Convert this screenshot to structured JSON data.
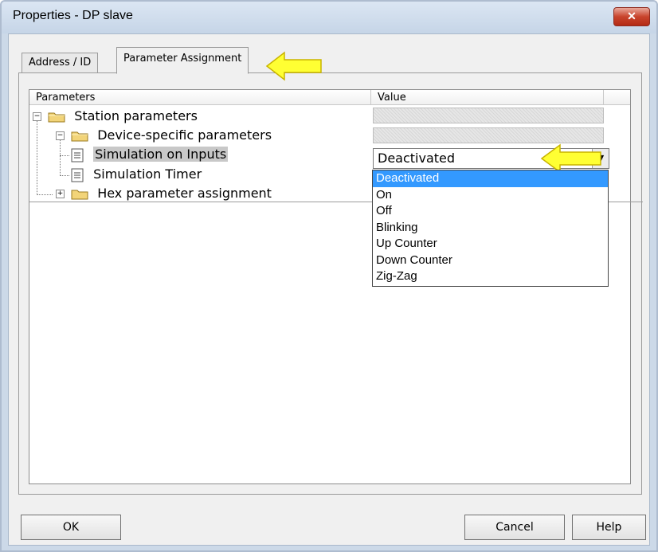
{
  "window": {
    "title": "Properties - DP slave",
    "close_glyph": "✕"
  },
  "tabs": [
    {
      "label": "Address / ID",
      "active": false
    },
    {
      "label": "Parameter Assignment",
      "active": true
    }
  ],
  "grid": {
    "columns": [
      "Parameters",
      "Value"
    ],
    "tree": {
      "station": "Station parameters",
      "device": "Device-specific parameters",
      "sim_inputs": "Simulation on Inputs",
      "sim_timer": "Simulation Timer",
      "hex": "Hex parameter assignment"
    },
    "selected_value": "Deactivated",
    "options": [
      "Deactivated",
      "On",
      "Off",
      "Blinking",
      "Up Counter",
      "Down Counter",
      "Zig-Zag"
    ]
  },
  "buttons": {
    "ok": "OK",
    "cancel": "Cancel",
    "help": "Help"
  },
  "icons": [
    "folder-icon",
    "document-icon",
    "expand-icon",
    "collapse-icon",
    "dropdown-arrow-icon",
    "highlight-arrow-icon",
    "close-icon"
  ],
  "colors": {
    "selection": "#3399ff",
    "callout_arrow": "#ffff33",
    "close_button": "#c8432c"
  }
}
